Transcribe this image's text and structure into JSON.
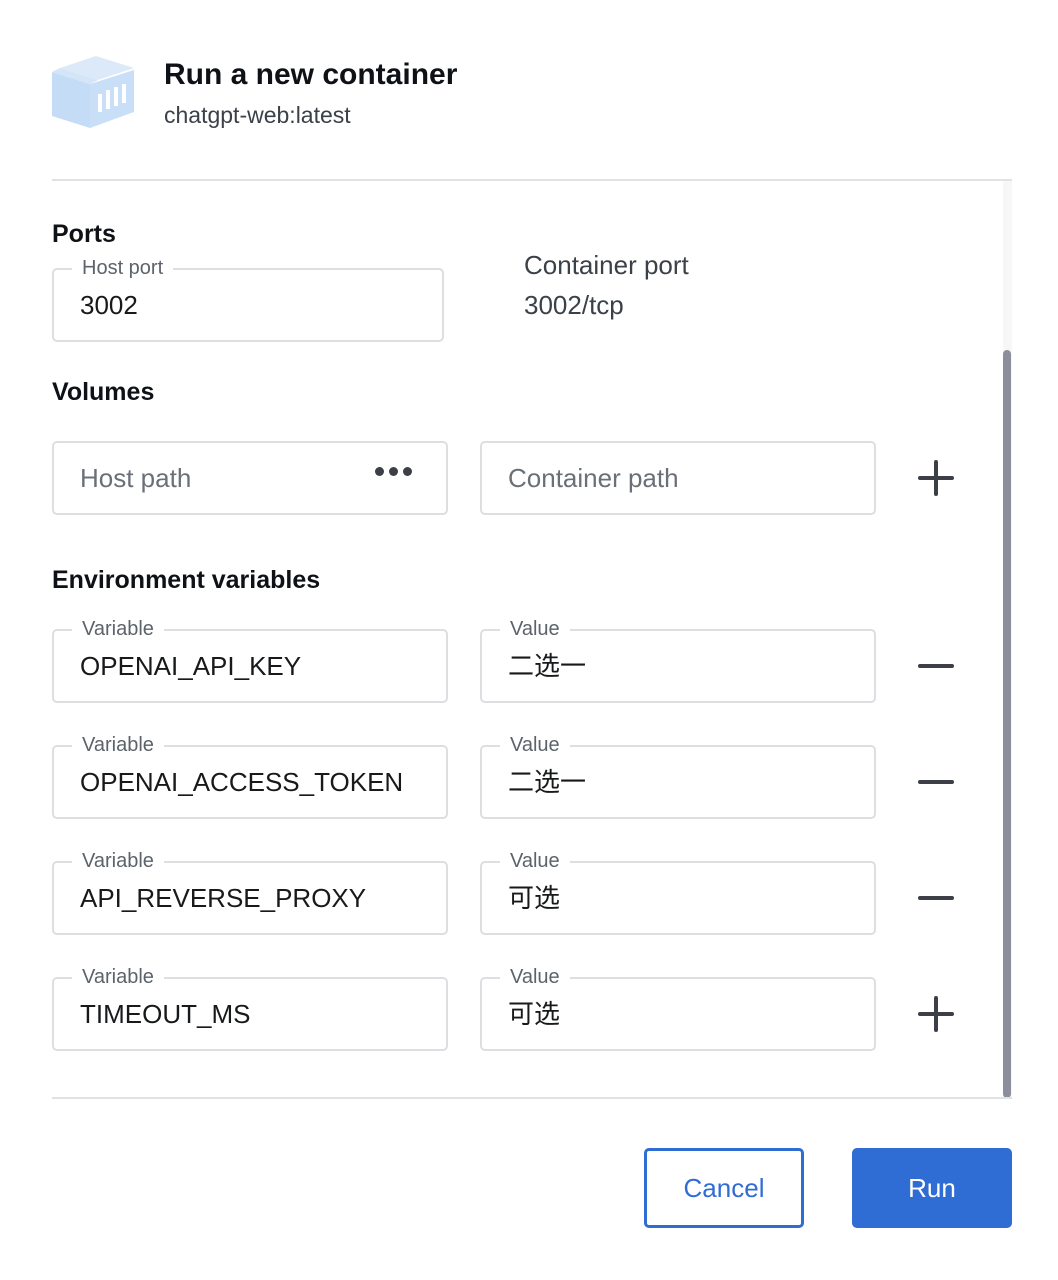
{
  "header": {
    "title": "Run a new container",
    "image": "chatgpt-web:latest",
    "icon": "container-cube-icon"
  },
  "ports": {
    "section_title": "Ports",
    "host_port_label": "Host port",
    "host_port_value": "3002",
    "container_port_label": "Container port",
    "container_port_value": "3002/tcp"
  },
  "volumes": {
    "section_title": "Volumes",
    "host_path_placeholder": "Host path",
    "container_path_placeholder": "Container path"
  },
  "env": {
    "section_title": "Environment variables",
    "rows": [
      {
        "variable_label": "Variable",
        "variable": "OPENAI_API_KEY",
        "value_label": "Value",
        "value": "二选一",
        "action": "minus-icon"
      },
      {
        "variable_label": "Variable",
        "variable": "OPENAI_ACCESS_TOKEN",
        "value_label": "Value",
        "value": "二选一",
        "action": "minus-icon"
      },
      {
        "variable_label": "Variable",
        "variable": "API_REVERSE_PROXY",
        "value_label": "Value",
        "value": "可选",
        "action": "minus-icon"
      },
      {
        "variable_label": "Variable",
        "variable": "TIMEOUT_MS",
        "value_label": "Value",
        "value": "可选",
        "action": "plus-icon"
      }
    ]
  },
  "footer": {
    "cancel_label": "Cancel",
    "run_label": "Run"
  },
  "colors": {
    "accent": "#2f6cd3",
    "border": "#dcdee2",
    "scrollbar": "#8c8f9b",
    "cube": "#c9dff7"
  }
}
